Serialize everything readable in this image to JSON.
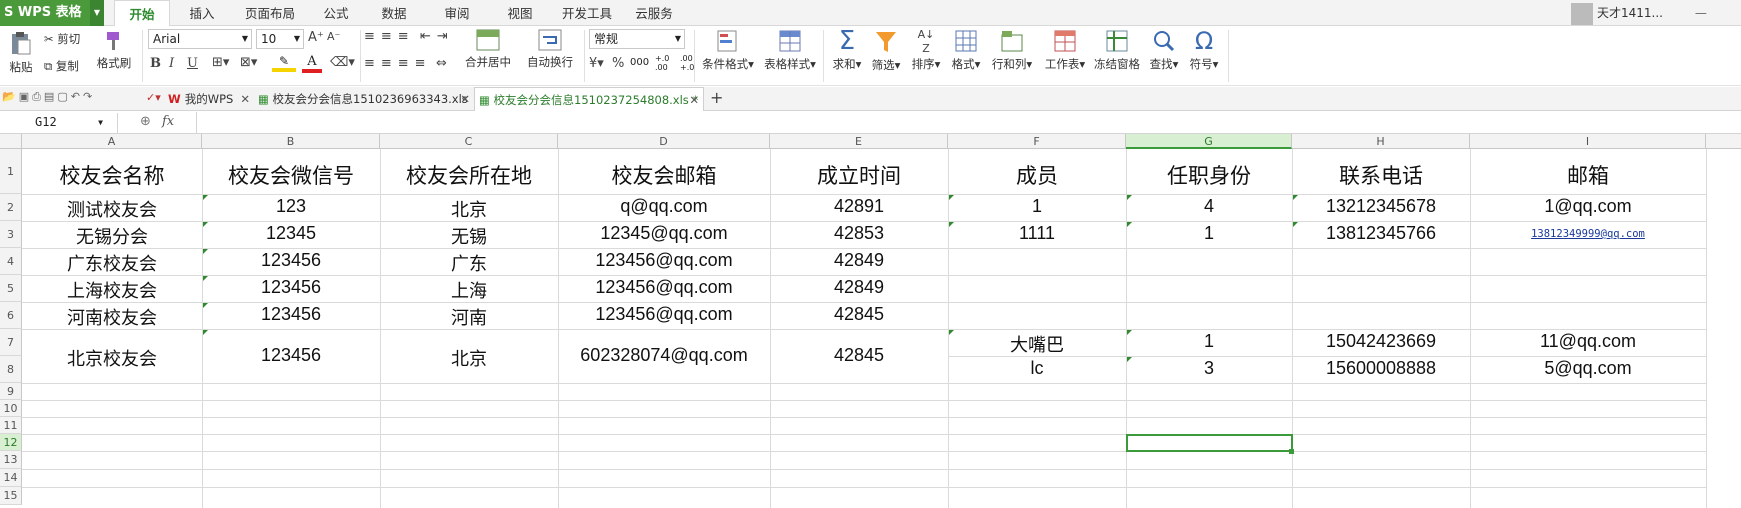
{
  "app": {
    "name": "WPS 表格"
  },
  "menu": {
    "tabs": [
      "开始",
      "插入",
      "页面布局",
      "公式",
      "数据",
      "审阅",
      "视图",
      "开发工具",
      "云服务"
    ],
    "active": "开始"
  },
  "user": {
    "name": "天才1411..."
  },
  "ribbon": {
    "paste": "粘贴",
    "cut": "剪切",
    "copy": "复制",
    "format_painter": "格式刷",
    "font_name": "Arial",
    "font_size": "10",
    "bold": "B",
    "italic": "I",
    "underline": "U",
    "merge_center": "合并居中",
    "wrap_text": "自动换行",
    "number_format": "常规",
    "percent": "%",
    "comma": "000",
    "decimal_inc": "+.0 .00",
    "decimal_dec": ".00 +.0",
    "conditional_format": "条件格式",
    "table_style": "表格样式",
    "sum": "求和",
    "filter": "筛选",
    "sort": "排序",
    "format": "格式",
    "row_col": "行和列",
    "worksheet": "工作表",
    "freeze": "冻结窗格",
    "find": "查找",
    "symbol": "符号"
  },
  "doc_tabs": [
    {
      "label": "我的WPS",
      "active": false
    },
    {
      "label": "校友会分会信息1510236963343.xls",
      "active": false
    },
    {
      "label": "校友会分会信息1510237254808.xls *",
      "active": true
    }
  ],
  "formula_bar": {
    "cell_ref": "G12",
    "fx": "fx",
    "value": ""
  },
  "sheet": {
    "columns": [
      "A",
      "B",
      "C",
      "D",
      "E",
      "F",
      "G",
      "H",
      "I"
    ],
    "selected_column": "G",
    "row_numbers": [
      "1",
      "2",
      "3",
      "4",
      "5",
      "6",
      "7",
      "8",
      "9",
      "10",
      "11",
      "12",
      "13",
      "14",
      "15"
    ],
    "selected_row": "12",
    "headers": [
      "校友会名称",
      "校友会微信号",
      "校友会所在地",
      "校友会邮箱",
      "成立时间",
      "成员",
      "任职身份",
      "联系电话",
      "邮箱"
    ],
    "rows": [
      [
        "测试校友会",
        "123",
        "北京",
        "q@qq.com",
        "42891",
        "1",
        "4",
        "13212345678",
        "1@qq.com"
      ],
      [
        "无锡分会",
        "12345",
        "无锡",
        "12345@qq.com",
        "42853",
        "1111",
        "1",
        "13812345766",
        "13812349999@qq.com"
      ],
      [
        "广东校友会",
        "123456",
        "广东",
        "123456@qq.com",
        "42849",
        "",
        "",
        "",
        ""
      ],
      [
        "上海校友会",
        "123456",
        "上海",
        "123456@qq.com",
        "42849",
        "",
        "",
        "",
        ""
      ],
      [
        "河南校友会",
        "123456",
        "河南",
        "123456@qq.com",
        "42845",
        "",
        "",
        "",
        ""
      ]
    ],
    "merged_row": {
      "name": "北京校友会",
      "wechat": "123456",
      "location": "北京",
      "email": "602328074@qq.com",
      "date": "42845"
    },
    "row7": {
      "member": "大嘴巴",
      "role": "1",
      "phone": "15042423669",
      "email": "11@qq.com"
    },
    "row8": {
      "member": "lc",
      "role": "3",
      "phone": "15600008888",
      "email": "5@qq.com"
    }
  }
}
